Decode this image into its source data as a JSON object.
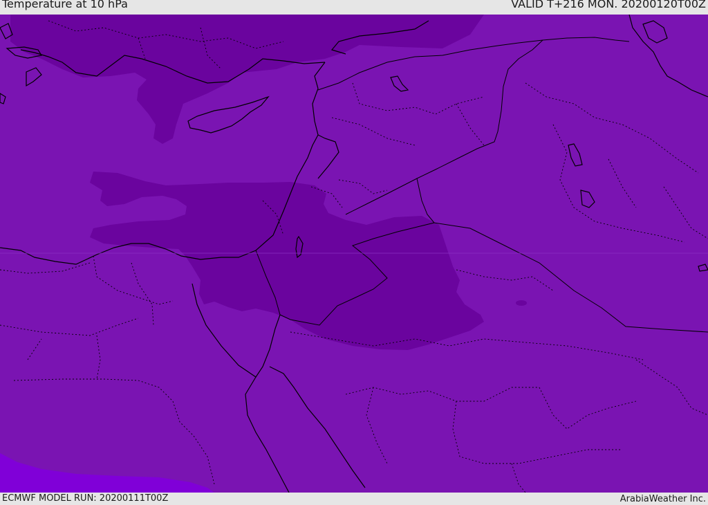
{
  "header": {
    "title": "Temperature at 10 hPa",
    "valid": "VALID T+216 MON. 20200120T00Z"
  },
  "footer": {
    "model_run": "ECMWF MODEL RUN: 20200111T00Z",
    "credit": "ArabiaWeather Inc."
  },
  "map": {
    "base_color": "#7a14b2",
    "colder_band_color": "#6a049e",
    "warmer_band_color": "#8000d8",
    "boundary_color": "#000000"
  }
}
